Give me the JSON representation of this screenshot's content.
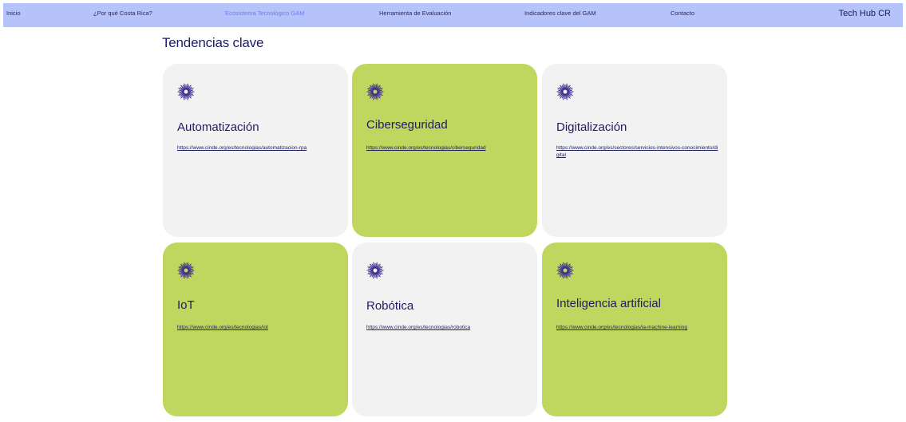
{
  "nav": {
    "items": [
      {
        "label": "Inicio"
      },
      {
        "label": "¿Por qué Costa Rica?"
      },
      {
        "label": "Ecosistema Tecnológico GAM"
      },
      {
        "label": "Herramienta de Evaluación"
      },
      {
        "label": "Indicadores clave del GAM"
      },
      {
        "label": "Contacto"
      }
    ],
    "brand": "Tech Hub CR",
    "active_color": "#6b7df2",
    "background_color": "#b6c3fb"
  },
  "section": {
    "title": "Tendencias clave"
  },
  "cards": [
    {
      "title": "Automatización",
      "link": "https://www.cinde.org/es/tecnologias/automatizacion-rpa",
      "icon": "starburst-icon",
      "color": "#f2f2f3"
    },
    {
      "title": "Ciberseguridad",
      "link": "https://www.cinde.org/es/tecnologias/ciberseguridad",
      "icon": "starburst-icon",
      "color": "#bfd75e"
    },
    {
      "title": "Digitalización",
      "link": "https://www.cinde.org/es/sectores/servicios-intensivos-conocimiento/digital",
      "icon": "starburst-icon",
      "color": "#f2f2f3"
    },
    {
      "title": "IoT",
      "link": "https://www.cinde.org/es/tecnologias/iot",
      "icon": "starburst-icon",
      "color": "#bfd75e"
    },
    {
      "title": "Robótica",
      "link": "https://www.cinde.org/es/tecnologias/robotica",
      "icon": "starburst-icon",
      "color": "#f2f2f3"
    },
    {
      "title": "Inteligencia artificial",
      "link": "https://www.cinde.org/es/tecnologias/ia-machine-learning",
      "icon": "starburst-icon",
      "color": "#bfd75e"
    }
  ]
}
